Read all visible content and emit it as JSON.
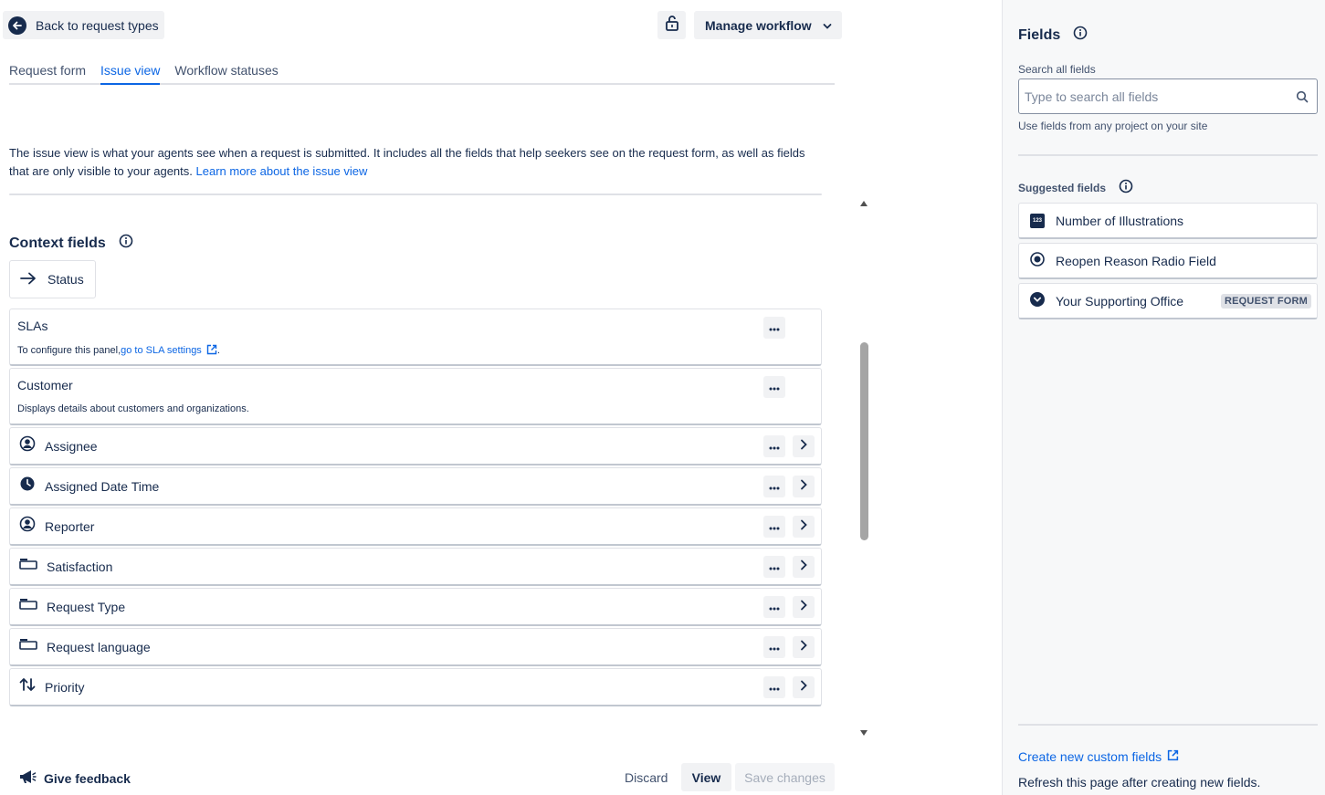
{
  "header": {
    "back_label": "Back to request types",
    "manage_label": "Manage workflow"
  },
  "tabs": [
    {
      "label": "Request form",
      "active": false
    },
    {
      "label": "Issue view",
      "active": true
    },
    {
      "label": "Workflow statuses",
      "active": false
    }
  ],
  "description": {
    "text": "The issue view is what your agents see when a request is submitted. It includes all the fields that help seekers see on the request form, as well as fields that are only visible to your agents. ",
    "link": "Learn more about the issue view"
  },
  "context": {
    "title": "Context fields",
    "status_label": "Status",
    "slas": {
      "title": "SLAs",
      "sub_prefix": "To configure this panel,",
      "sub_link": "go to SLA settings",
      "sub_suffix": "."
    },
    "customer": {
      "title": "Customer",
      "sub": "Displays details about customers and organizations."
    },
    "rows": [
      {
        "label": "Assignee",
        "icon": "person-circle-icon"
      },
      {
        "label": "Assigned Date Time",
        "icon": "clock-icon"
      },
      {
        "label": "Reporter",
        "icon": "person-circle-icon"
      },
      {
        "label": "Satisfaction",
        "icon": "text-field-icon"
      },
      {
        "label": "Request Type",
        "icon": "text-field-icon"
      },
      {
        "label": "Request language",
        "icon": "text-field-icon"
      },
      {
        "label": "Priority",
        "icon": "priority-arrows-icon"
      }
    ]
  },
  "footer": {
    "feedback_label": "Give feedback",
    "discard_label": "Discard",
    "view_label": "View",
    "save_label": "Save changes"
  },
  "sidebar": {
    "title": "Fields",
    "search_label": "Search all fields",
    "search_placeholder": "Type to search all fields",
    "search_value": "",
    "search_hint": "Use fields from any project on your site",
    "suggested_title": "Suggested fields",
    "suggested": [
      {
        "label": "Number of Illustrations",
        "icon": "number-field-icon"
      },
      {
        "label": "Reopen Reason Radio Field",
        "icon": "radio-icon"
      },
      {
        "label": "Your Supporting Office",
        "icon": "dropdown-circle-icon",
        "badge": "REQUEST FORM"
      }
    ],
    "icon_badge_text": "123",
    "create_link": "Create new custom fields",
    "refresh_note": "Refresh this page after creating new fields."
  },
  "colors": {
    "primary_text": "#172b4d",
    "link": "#0c66e4",
    "button_bg": "#f1f2f4",
    "border": "#dfe1e6"
  }
}
